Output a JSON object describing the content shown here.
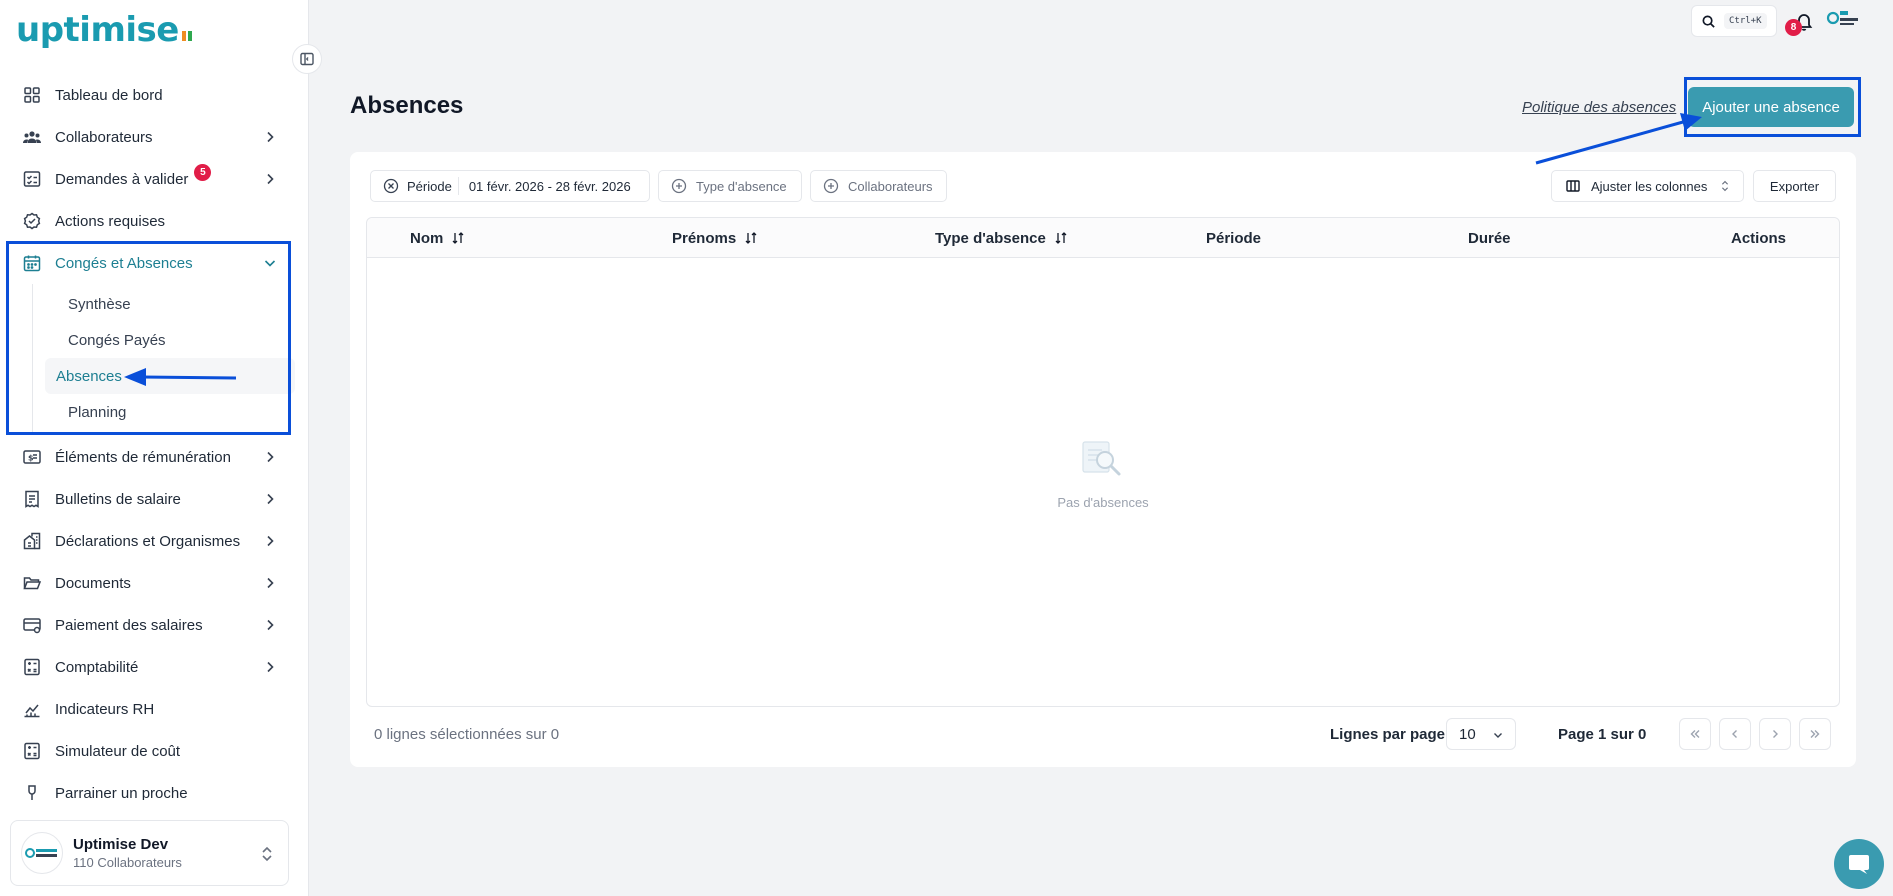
{
  "brand": {
    "logo_text": "uptimise",
    "accent": "#1a9bb0",
    "flag_colors": [
      "#f08c22",
      "#ffffff",
      "#2fa84f"
    ]
  },
  "sidebar": {
    "items": [
      {
        "label": "Tableau de bord",
        "icon": "dashboard-grid-icon",
        "chevron": false
      },
      {
        "label": "Collaborateurs",
        "icon": "users-icon",
        "chevron": true
      },
      {
        "label": "Demandes à valider",
        "icon": "checklist-icon",
        "chevron": true,
        "badge": "5"
      },
      {
        "label": "Actions requises",
        "icon": "badge-check-icon",
        "chevron": false
      },
      {
        "label": "Congés et Absences",
        "icon": "calendar-icon",
        "chevron": true,
        "expanded": true
      },
      {
        "label": "Éléments de rémunération",
        "icon": "dollar-card-icon",
        "chevron": true
      },
      {
        "label": "Bulletins de salaire",
        "icon": "receipt-icon",
        "chevron": true
      },
      {
        "label": "Déclarations et Organismes",
        "icon": "buildings-icon",
        "chevron": true
      },
      {
        "label": "Documents",
        "icon": "folder-icon",
        "chevron": true
      },
      {
        "label": "Paiement des salaires",
        "icon": "card-settings-icon",
        "chevron": true
      },
      {
        "label": "Comptabilité",
        "icon": "calculator-icon",
        "chevron": true
      },
      {
        "label": "Indicateurs RH",
        "icon": "chart-icon",
        "chevron": false
      },
      {
        "label": "Simulateur de coût",
        "icon": "calculator-icon",
        "chevron": false
      },
      {
        "label": "Parrainer un proche",
        "icon": "gift-icon",
        "chevron": false
      }
    ],
    "subitems": [
      {
        "label": "Synthèse"
      },
      {
        "label": "Congés Payés"
      },
      {
        "label": "Absences",
        "active": true
      },
      {
        "label": "Planning"
      }
    ],
    "company": {
      "name": "Uptimise Dev",
      "sub": "110 Collaborateurs"
    }
  },
  "topbar": {
    "search_shortcut": "Ctrl+K",
    "notifications": "8"
  },
  "page": {
    "title": "Absences",
    "policy_link": "Politique des absences",
    "add_button": "Ajouter une absence"
  },
  "filters": {
    "periode_label": "Période",
    "periode_value": "01 févr. 2026 - 28 févr. 2026",
    "type_label": "Type d'absence",
    "collab_label": "Collaborateurs",
    "columns_label": "Ajuster les colonnes",
    "export_label": "Exporter"
  },
  "table": {
    "columns": [
      "Nom",
      "Prénoms",
      "Type d'absence",
      "Période",
      "Durée",
      "Actions"
    ],
    "empty_text": "Pas d'absences"
  },
  "footer": {
    "selected": "0 lignes sélectionnées sur 0",
    "rows_label": "Lignes par page",
    "rows_value": "10",
    "page_info": "Page 1 sur 0"
  },
  "annotation_color": "#0a4fd9"
}
